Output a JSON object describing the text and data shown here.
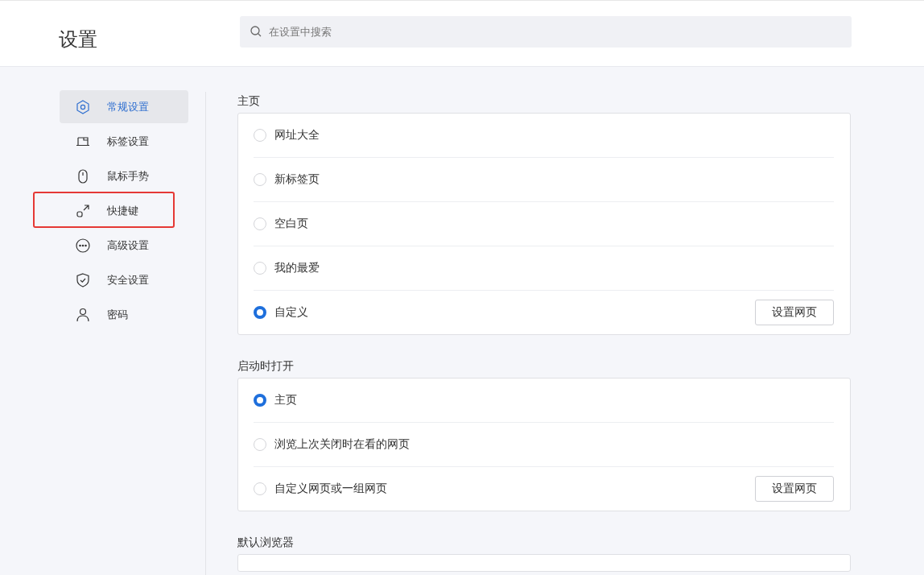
{
  "header": {
    "title": "设置",
    "search": {
      "placeholder": "在设置中搜索"
    }
  },
  "sidebar": {
    "items": [
      {
        "label": "常规设置",
        "kind": "hexagon",
        "selected": true,
        "highlighted": false
      },
      {
        "label": "标签设置",
        "kind": "tab",
        "selected": false,
        "highlighted": false
      },
      {
        "label": "鼠标手势",
        "kind": "mouse",
        "selected": false,
        "highlighted": false
      },
      {
        "label": "快捷键",
        "kind": "shortcut",
        "selected": false,
        "highlighted": true
      },
      {
        "label": "高级设置",
        "kind": "more",
        "selected": false,
        "highlighted": false
      },
      {
        "label": "安全设置",
        "kind": "shield",
        "selected": false,
        "highlighted": false
      },
      {
        "label": "密码",
        "kind": "user",
        "selected": false,
        "highlighted": false
      }
    ]
  },
  "sections": [
    {
      "title": "主页",
      "options": [
        {
          "label": "网址大全",
          "selected": false
        },
        {
          "label": "新标签页",
          "selected": false
        },
        {
          "label": "空白页",
          "selected": false
        },
        {
          "label": "我的最爱",
          "selected": false
        },
        {
          "label": "自定义",
          "selected": true,
          "button": "设置网页"
        }
      ]
    },
    {
      "title": "启动时打开",
      "options": [
        {
          "label": "主页",
          "selected": true
        },
        {
          "label": "浏览上次关闭时在看的网页",
          "selected": false
        },
        {
          "label": "自定义网页或一组网页",
          "selected": false,
          "button": "设置网页"
        }
      ]
    },
    {
      "title": "默认浏览器"
    }
  ]
}
